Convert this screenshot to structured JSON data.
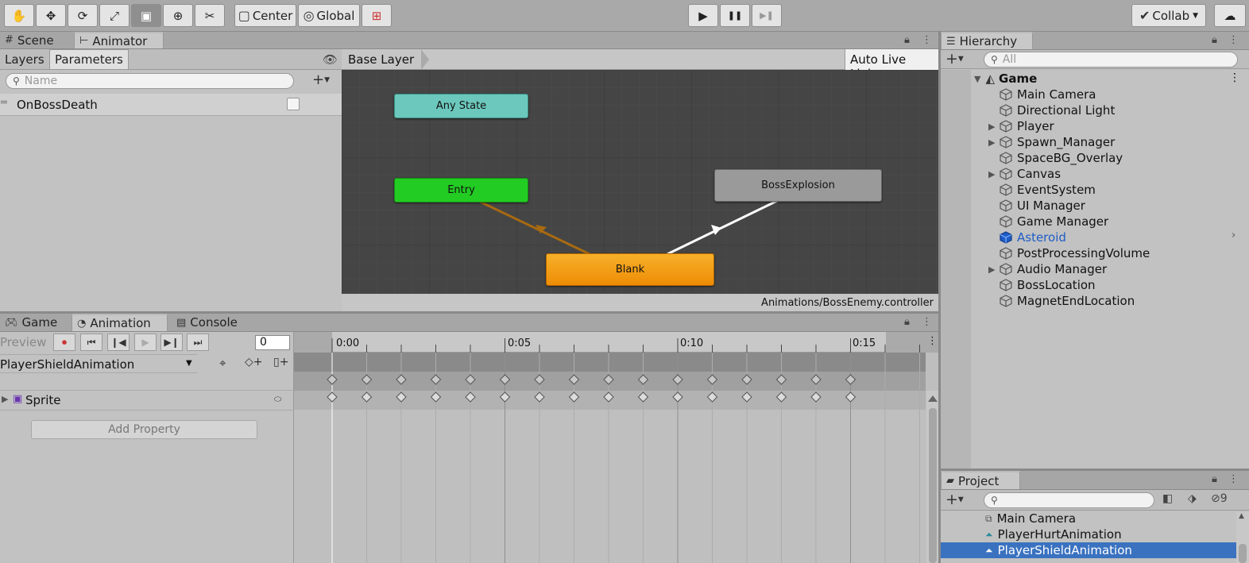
{
  "toolbar": {
    "tools": [
      "hand-tool",
      "move-tool",
      "rotate-tool",
      "scale-tool",
      "rect-tool",
      "transform-tool",
      "custom-tool"
    ],
    "pivot_mode": "Center",
    "pivot_rotation": "Global",
    "collab": "Collab",
    "play_label": "▶",
    "pause_label": "❚❚",
    "step_label": "▶❚"
  },
  "animator_window": {
    "tabs": [
      "Scene",
      "Animator"
    ],
    "subtabs": [
      "Layers",
      "Parameters"
    ],
    "search_placeholder": "Name",
    "parameters": [
      {
        "name": "OnBossDeath",
        "value": false
      }
    ],
    "breadcrumb": "Base Layer",
    "auto_live_link": "Auto Live Link",
    "nodes": {
      "any_state": "Any State",
      "entry": "Entry",
      "boss_explosion": "BossExplosion",
      "blank": "Blank"
    },
    "controller_path": "Animations/BossEnemy.controller"
  },
  "animation_window": {
    "tabs": [
      "Game",
      "Animation",
      "Console"
    ],
    "preview": "Preview",
    "frame_value": "0",
    "clip": "PlayerShieldAnimation",
    "time_labels": [
      "0:00",
      "0:05",
      "0:10",
      "0:15"
    ],
    "property": "Sprite",
    "add_property": "Add Property"
  },
  "hierarchy": {
    "title": "Hierarchy",
    "search_placeholder": "All",
    "scene": "Game",
    "items": [
      {
        "name": "Main Camera",
        "expandable": false,
        "selected": false
      },
      {
        "name": "Directional Light",
        "expandable": false,
        "selected": false
      },
      {
        "name": "Player",
        "expandable": true,
        "selected": false
      },
      {
        "name": "Spawn_Manager",
        "expandable": true,
        "selected": false
      },
      {
        "name": "SpaceBG_Overlay",
        "expandable": false,
        "selected": false
      },
      {
        "name": "Canvas",
        "expandable": true,
        "selected": false
      },
      {
        "name": "EventSystem",
        "expandable": false,
        "selected": false
      },
      {
        "name": "UI Manager",
        "expandable": false,
        "selected": false
      },
      {
        "name": "Game Manager",
        "expandable": false,
        "selected": false
      },
      {
        "name": "Asteroid",
        "expandable": false,
        "selected": true
      },
      {
        "name": "PostProcessingVolume",
        "expandable": false,
        "selected": false
      },
      {
        "name": "Audio Manager",
        "expandable": true,
        "selected": false
      },
      {
        "name": "BossLocation",
        "expandable": false,
        "selected": false
      },
      {
        "name": "MagnetEndLocation",
        "expandable": false,
        "selected": false
      }
    ]
  },
  "project": {
    "title": "Project",
    "hidden_count": "9",
    "items": [
      {
        "name": "Main Camera",
        "selected": false
      },
      {
        "name": "PlayerHurtAnimation",
        "selected": false
      },
      {
        "name": "PlayerShieldAnimation",
        "selected": true
      }
    ]
  },
  "colors": {
    "any_state": "#6cc8bc",
    "entry": "#22cc22",
    "blank": "#f5a012",
    "boss_explosion": "#9a9a9a",
    "selection": "#3a72c0",
    "prefab_blue": "#1e5cc6"
  }
}
